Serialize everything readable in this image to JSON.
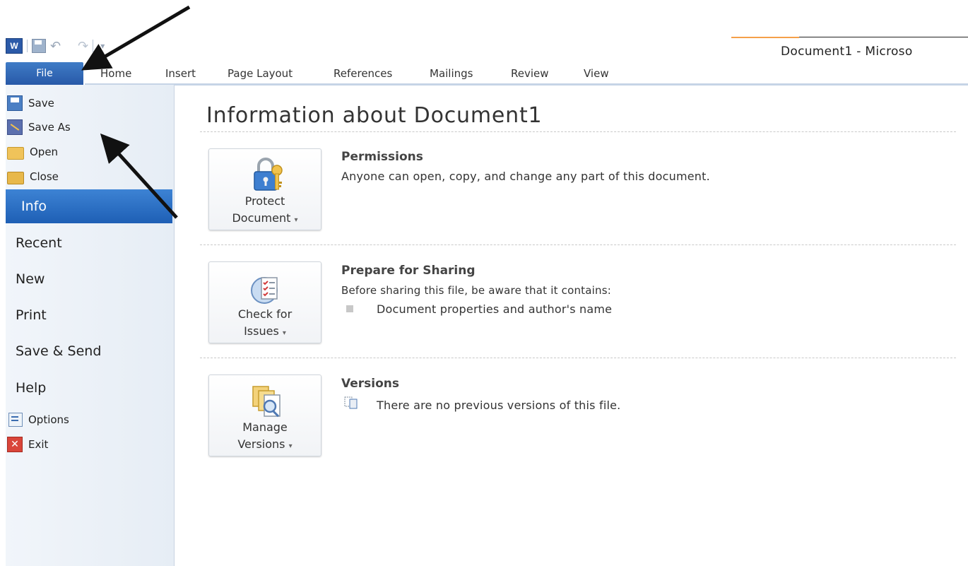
{
  "window": {
    "title": "Document1 - Microso"
  },
  "quick_access": {
    "items": [
      {
        "name": "word-icon"
      },
      {
        "name": "save-icon"
      },
      {
        "name": "undo-icon"
      },
      {
        "name": "redo-icon"
      }
    ],
    "customize": "▾"
  },
  "ribbon": {
    "file_tab": "File",
    "tabs": [
      "Home",
      "Insert",
      "Page Layout",
      "References",
      "Mailings",
      "Review",
      "View"
    ]
  },
  "backstage": {
    "commands_top": [
      {
        "label": "Save",
        "icon": "save-icon"
      },
      {
        "label": "Save As",
        "icon": "save-as-icon"
      },
      {
        "label": "Open",
        "icon": "open-folder-icon"
      },
      {
        "label": "Close",
        "icon": "close-folder-icon"
      }
    ],
    "selected": "Info",
    "nav": [
      "Recent",
      "New",
      "Print",
      "Save & Send",
      "Help"
    ],
    "commands_bottom": [
      {
        "label": "Options",
        "icon": "options-icon"
      },
      {
        "label": "Exit",
        "icon": "exit-icon"
      }
    ]
  },
  "main": {
    "title": "Information about Document1",
    "sections": [
      {
        "button_line1": "Protect",
        "button_line2": "Document",
        "icon": "lock-key-icon",
        "heading": "Permissions",
        "text": "Anyone can open, copy, and change any part of this document."
      },
      {
        "button_line1": "Check for",
        "button_line2": "Issues",
        "icon": "checklist-icon",
        "heading": "Prepare for Sharing",
        "text": "Before sharing this file, be aware that it contains:",
        "bullets": [
          "Document properties and author's name"
        ]
      },
      {
        "button_line1": "Manage",
        "button_line2": "Versions",
        "icon": "versions-icon",
        "heading": "Versions",
        "text": "There are no previous versions of this file."
      }
    ],
    "dropdown_glyph": "▾"
  },
  "colors": {
    "accent_blue": "#2a62b3",
    "title_accent": "#f5a04a",
    "pane_bg": "#eaf0f7"
  }
}
